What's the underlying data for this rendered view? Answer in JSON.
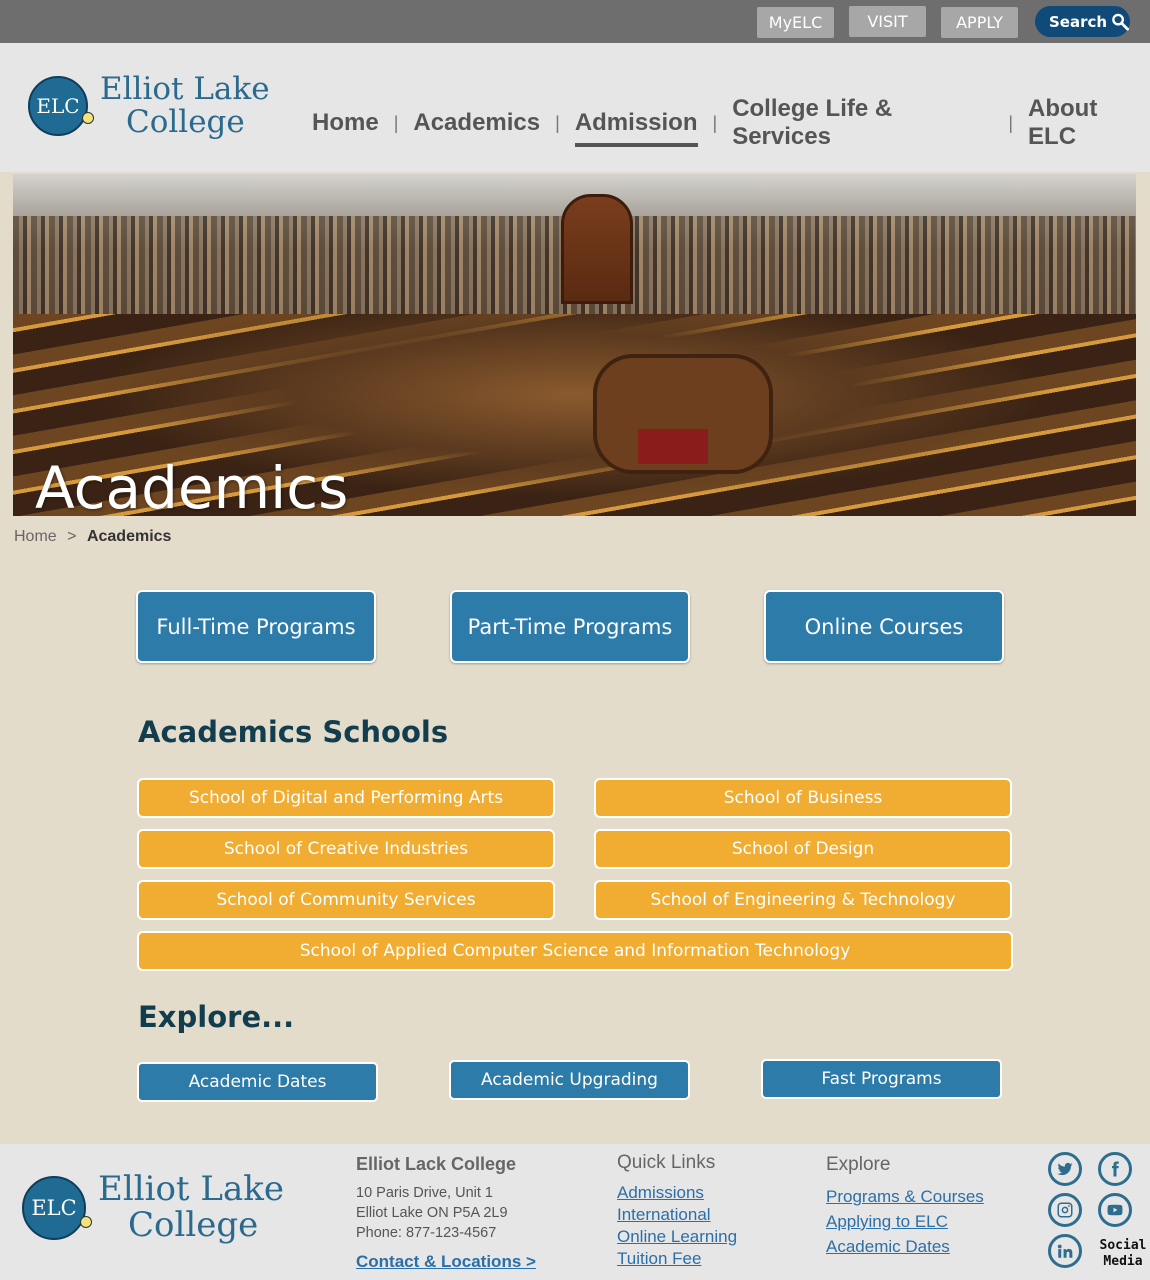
{
  "topbar": {
    "myelc": "MyELC",
    "visit": "VISIT",
    "apply": "APPLY",
    "search": "Search"
  },
  "brand": {
    "logo_initials": "ELC",
    "name_line1": "Elliot Lake",
    "name_line2": "College"
  },
  "nav": {
    "items": [
      "Home",
      "Academics",
      "Admission",
      "College Life & Services",
      "About ELC"
    ],
    "separator": "|",
    "active": "Admission"
  },
  "hero": {
    "title": "Academics"
  },
  "breadcrumb": {
    "home": "Home",
    "separator": ">",
    "current": "Academics"
  },
  "programs": [
    "Full-Time Programs",
    "Part-Time Programs",
    "Online Courses"
  ],
  "schools": {
    "title": "Academics Schools",
    "items": [
      "School of Digital and Performing Arts",
      "School of Business",
      "School of Creative Industries",
      "School of Design",
      "School of Community Services",
      "School of Engineering & Technology",
      "School of Applied Computer Science and Information Technology"
    ]
  },
  "explore": {
    "title": "Explore...",
    "items": [
      "Academic Dates",
      "Academic Upgrading",
      "Fast Programs"
    ]
  },
  "footer": {
    "college_heading": "Elliot Lack College",
    "address_line1": "10 Paris Drive, Unit 1",
    "address_line2": "Elliot Lake ON P5A 2L9",
    "phone": "Phone: 877-123-4567",
    "contact_link": "Contact & Locations >",
    "quick_links_title": "Quick Links",
    "quick_links": [
      "Admissions",
      "International",
      "Online Learning",
      "Tuition Fee"
    ],
    "explore_title": "Explore",
    "explore_links": [
      "Programs & Courses",
      "Applying to ELC",
      "Academic Dates"
    ],
    "social_label_line1": "Social",
    "social_label_line2": "Media"
  },
  "colors": {
    "primary_blue": "#2d7ba8",
    "dark_blue": "#0f4a78",
    "school_orange": "#f0ad32",
    "page_bg": "#e4dccb"
  }
}
